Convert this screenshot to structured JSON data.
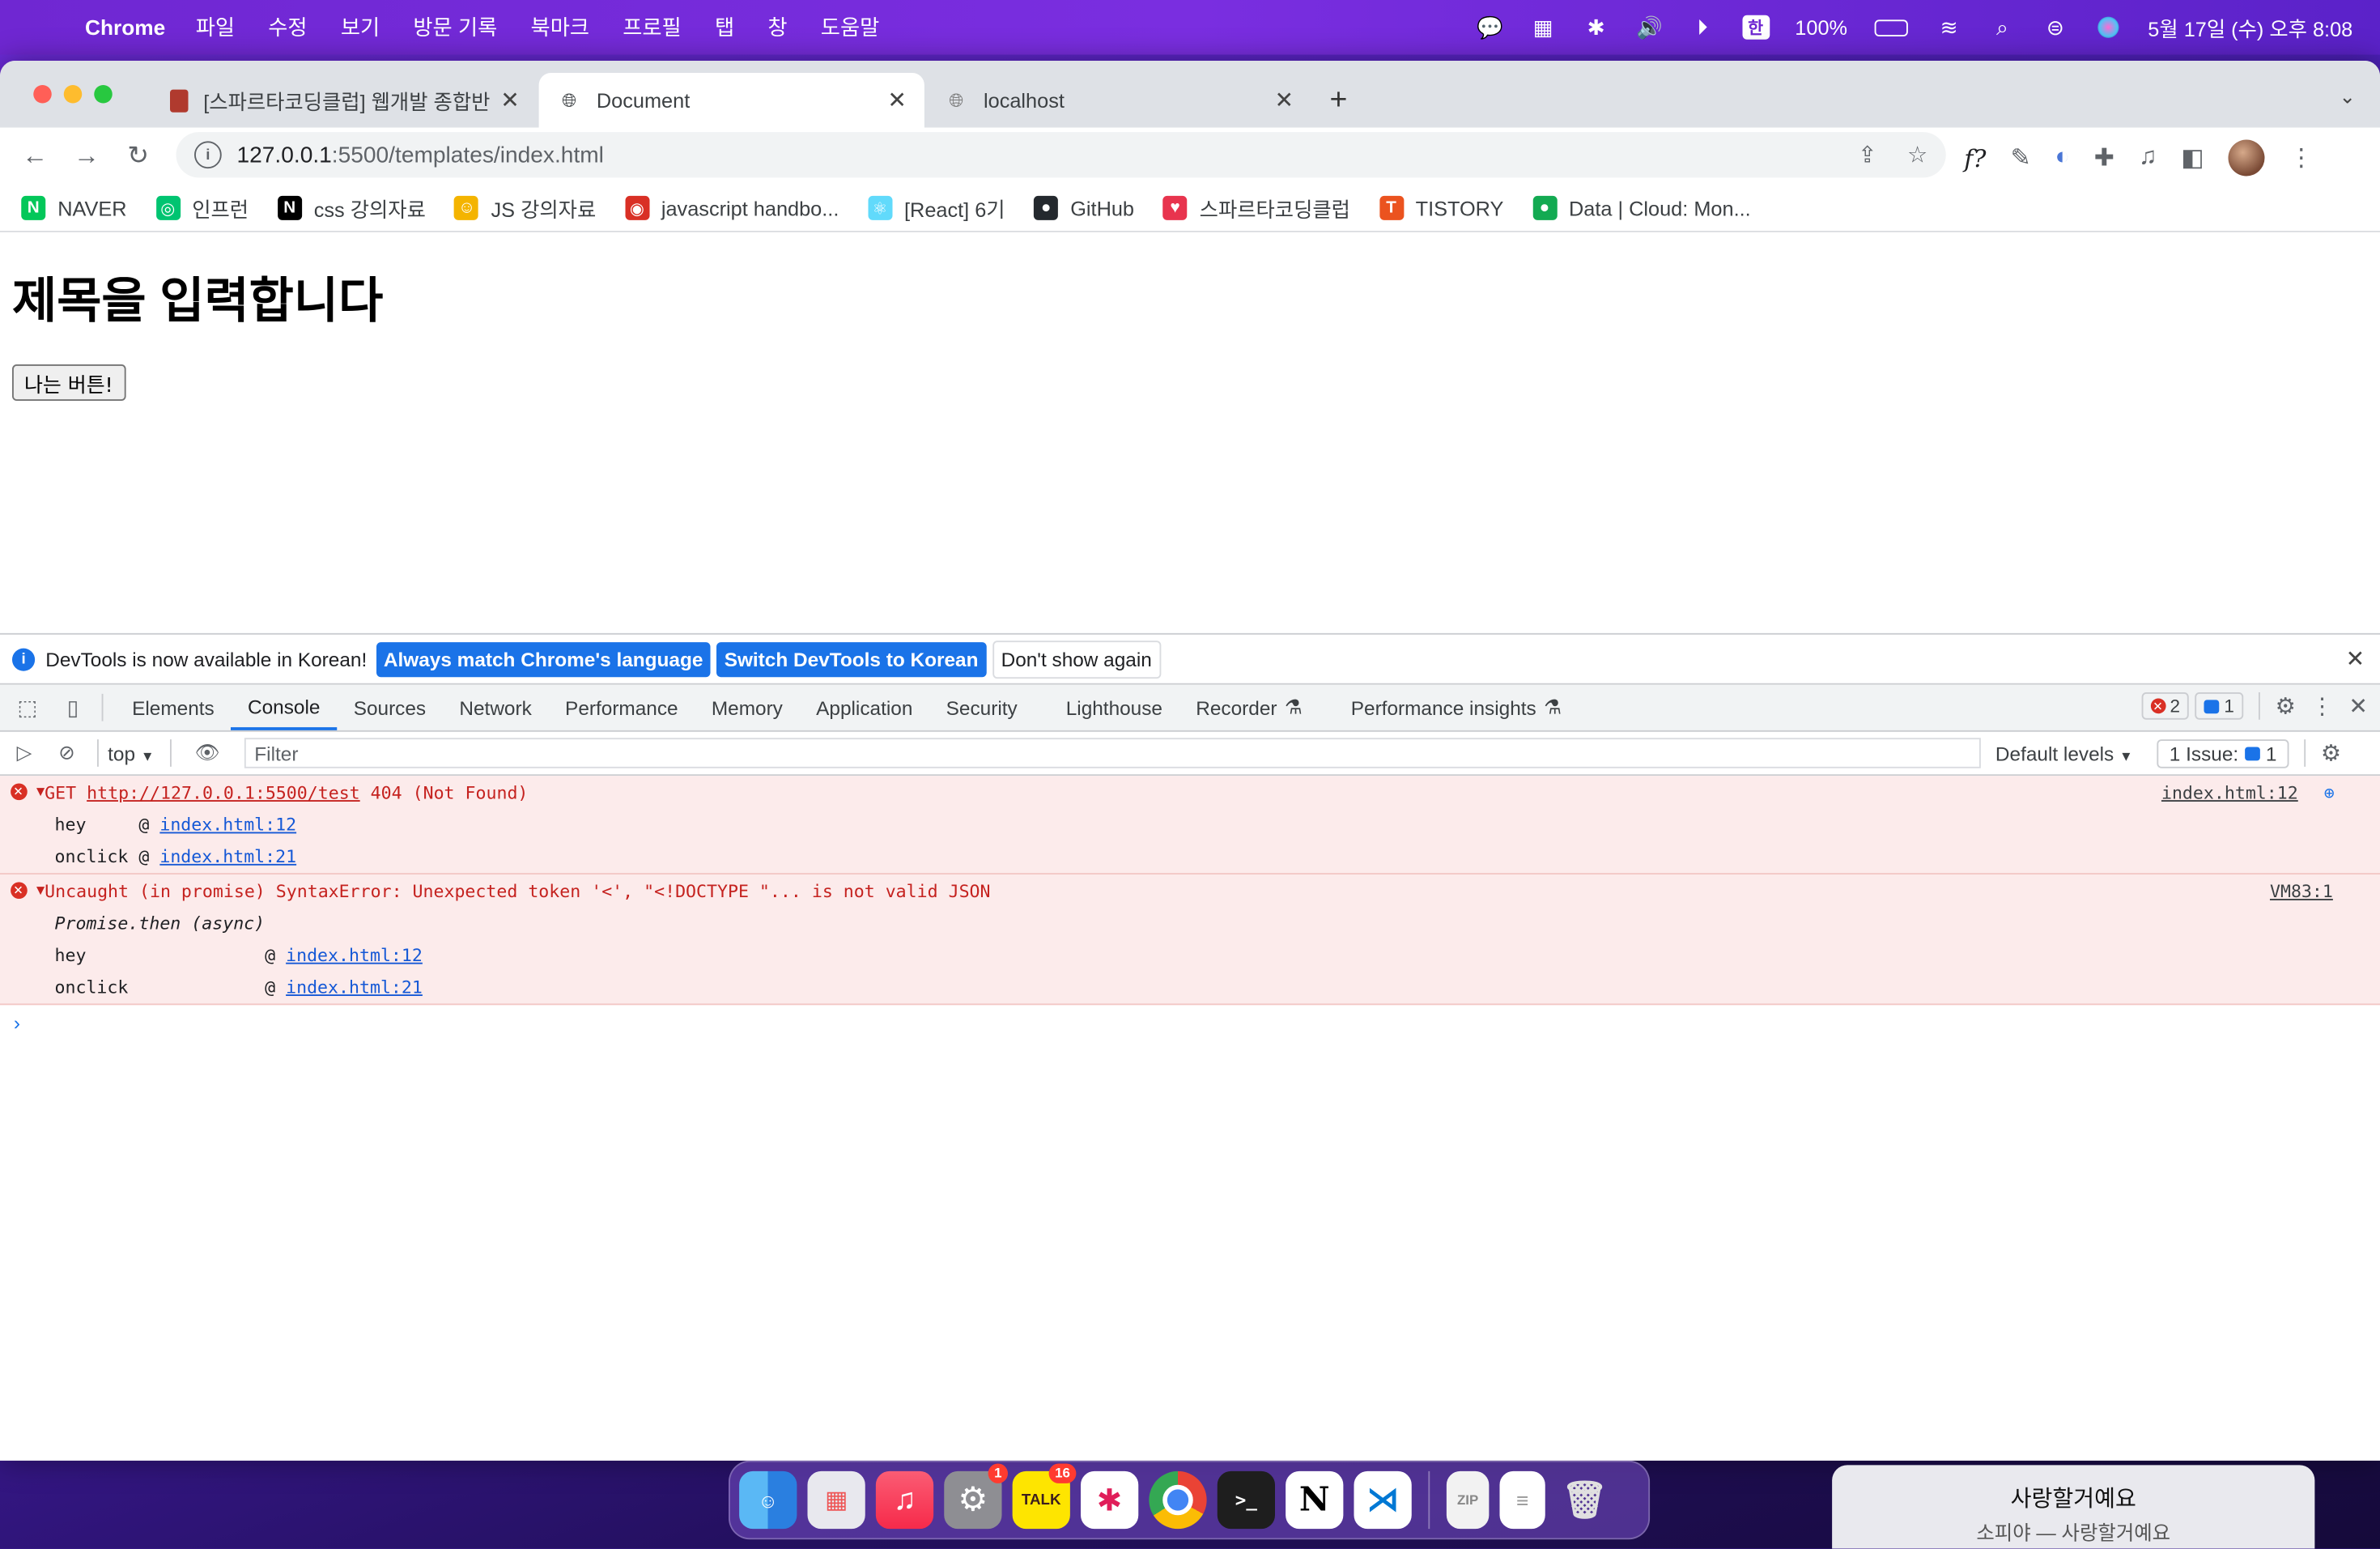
{
  "menubar": {
    "app_name": "Chrome",
    "menus": [
      "파일",
      "수정",
      "보기",
      "방문 기록",
      "북마크",
      "프로필",
      "탭",
      "창",
      "도움말"
    ],
    "battery": "100%",
    "input_lang": "한",
    "datetime": "5월 17일 (수) 오후 8:08"
  },
  "tabs": [
    {
      "title": "[스파르타코딩클럽] 웹개발 종합반 -",
      "icon": "book-icon"
    },
    {
      "title": "Document",
      "icon": "globe-icon"
    },
    {
      "title": "localhost",
      "icon": "globe-icon"
    }
  ],
  "address": {
    "host": "127.0.0.1",
    "path": ":5500/templates/index.html"
  },
  "bookmarks": [
    {
      "label": "NAVER",
      "color": "#03c75a",
      "glyph": "N"
    },
    {
      "label": "인프런",
      "color": "#00c471",
      "glyph": "◎"
    },
    {
      "label": "css 강의자료",
      "color": "#000000",
      "glyph": "N"
    },
    {
      "label": "JS 강의자료",
      "color": "#f4b400",
      "glyph": "☺"
    },
    {
      "label": "javascript handbo...",
      "color": "#d93025",
      "glyph": "◉"
    },
    {
      "label": "[React] 6기",
      "color": "#61dafb",
      "glyph": "⚛"
    },
    {
      "label": "GitHub",
      "color": "#24292e",
      "glyph": "●"
    },
    {
      "label": "스파르타코딩클럽",
      "color": "#e8344e",
      "glyph": "♥"
    },
    {
      "label": "TISTORY",
      "color": "#eb531f",
      "glyph": "T"
    },
    {
      "label": "Data | Cloud: Mon...",
      "color": "#13aa52",
      "glyph": "●"
    }
  ],
  "page": {
    "heading": "제목을 입력합니다",
    "button": "나는 버튼!"
  },
  "devtools": {
    "infobar": {
      "text": "DevTools is now available in Korean!",
      "btn1": "Always match Chrome's language",
      "btn2": "Switch DevTools to Korean",
      "btn3": "Don't show again"
    },
    "tabs": [
      "Elements",
      "Console",
      "Sources",
      "Network",
      "Performance",
      "Memory",
      "Application",
      "Security",
      "Lighthouse",
      "Recorder",
      "Performance insights"
    ],
    "error_count": "2",
    "message_count": "1",
    "context": "top",
    "filter_placeholder": "Filter",
    "levels": "Default levels",
    "issues": "1 Issue:",
    "issues_count": "1",
    "msg1": {
      "method": "GET",
      "url": "http://127.0.0.1:5500/test",
      "status": "404 (Not Found)",
      "source": "index.html:12",
      "frames": [
        {
          "fn": "hey     @ ",
          "link": "index.html:12"
        },
        {
          "fn": "onclick @ ",
          "link": "index.html:21"
        }
      ]
    },
    "msg2": {
      "text": "Uncaught (in promise) SyntaxError: Unexpected token '<', \"<!DOCTYPE \"... is not valid JSON",
      "source": "VM83:1",
      "async": "Promise.then (async)",
      "frames": [
        {
          "fn": "hey                 @ ",
          "link": "index.html:12"
        },
        {
          "fn": "onclick             @ ",
          "link": "index.html:21"
        }
      ]
    }
  },
  "dock": {
    "kakao_badge": "16",
    "settings_badge": "1",
    "kakao_label": "TALK"
  },
  "now_playing": {
    "title": "사랑할거예요",
    "subtitle": "소피야 — 사랑할거예요"
  }
}
